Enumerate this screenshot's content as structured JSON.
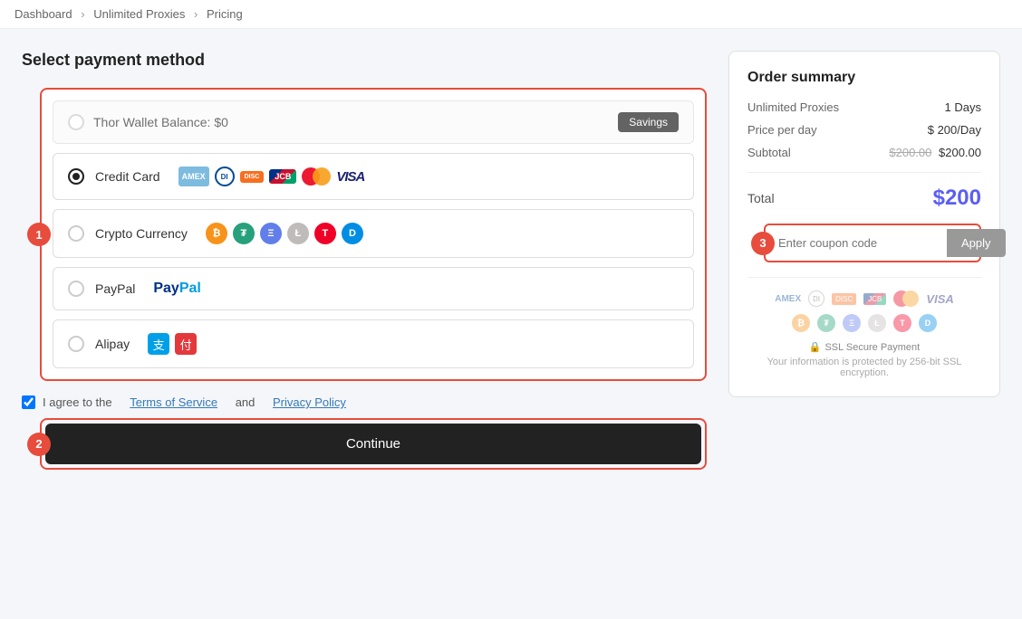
{
  "breadcrumb": {
    "items": [
      "Dashboard",
      "Unlimited Proxies",
      "Pricing"
    ],
    "separators": [
      ">",
      ">"
    ]
  },
  "page": {
    "title": "Select payment method"
  },
  "payment_methods": {
    "wallet": {
      "label": "Thor Wallet Balance: $0",
      "savings_button": "Savings"
    },
    "credit_card": {
      "label": "Credit Card",
      "selected": true
    },
    "crypto": {
      "label": "Crypto Currency",
      "selected": false
    },
    "paypal": {
      "label": "PayPal",
      "selected": false
    },
    "alipay": {
      "label": "Alipay",
      "selected": false
    }
  },
  "terms": {
    "text": "I agree to the",
    "terms_link": "Terms of Service",
    "and": "and",
    "privacy_link": "Privacy Policy"
  },
  "continue_button": "Continue",
  "order_summary": {
    "title": "Order summary",
    "rows": [
      {
        "label": "Unlimited Proxies",
        "value": "1 Days"
      },
      {
        "label": "Price per day",
        "value": "$ 200/Day"
      },
      {
        "label": "Subtotal",
        "original": "$200.00",
        "value": "$200.00"
      }
    ],
    "total_label": "Total",
    "total_value": "$200",
    "coupon_placeholder": "Enter coupon code",
    "apply_button": "Apply",
    "ssl_label": "SSL Secure Payment",
    "ssl_desc": "Your information is protected by 256-bit SSL encryption."
  },
  "badges": {
    "one": "1",
    "two": "2",
    "three": "3"
  }
}
